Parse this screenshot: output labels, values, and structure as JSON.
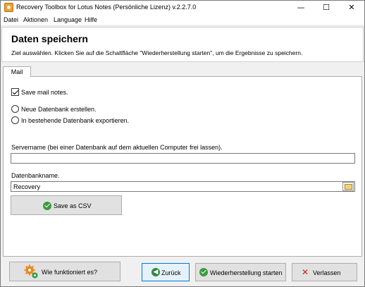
{
  "window": {
    "title": "Recovery Toolbox for Lotus Notes (Persönliche Lizenz) v.2.2.7.0",
    "controls": {
      "minimize": "—",
      "maximize": "☐",
      "close": "✕"
    }
  },
  "menu": [
    {
      "label": "Datei"
    },
    {
      "label": "Aktionen"
    },
    {
      "label": "Language"
    },
    {
      "label": "Hilfe"
    }
  ],
  "header": {
    "title": "Daten speichern",
    "subtitle": "Ziel auswählen. Klicken Sie auf die Schaltfläche \"Wiederherstellung starten\", um die Ergebnisse zu speichern."
  },
  "tab": {
    "label": "Mail"
  },
  "options": {
    "save_mail_notes": {
      "label": "Save mail notes.",
      "checked": true
    },
    "radio_new_db": {
      "label": "Neue Datenbank erstellen.",
      "selected": false
    },
    "radio_existing_db": {
      "label": "In bestehende Datenbank exportieren.",
      "selected": false
    }
  },
  "servername": {
    "label": "Servername (bei einer Datenbank auf dem aktuellen Computer frei lassen).",
    "value": ""
  },
  "dbname": {
    "label": "Datenbankname.",
    "value": "Recovery"
  },
  "buttons": {
    "save_csv": "Save as CSV",
    "how_it_works": "Wie funktioniert es?",
    "back": "Zurück",
    "start_recovery": "Wiederherstellung starten",
    "exit": "Verlassen"
  },
  "icons": {
    "app": "app-icon",
    "check": "check-icon",
    "back": "back-arrow-icon",
    "exit": "x-icon",
    "gear": "gears-icon",
    "browse": "folder-icon"
  },
  "colors": {
    "accent_green": "#3b9b3b",
    "exit_red": "#d21b1b",
    "gear_orange": "#e8891c",
    "gear_green": "#2e9a45"
  }
}
